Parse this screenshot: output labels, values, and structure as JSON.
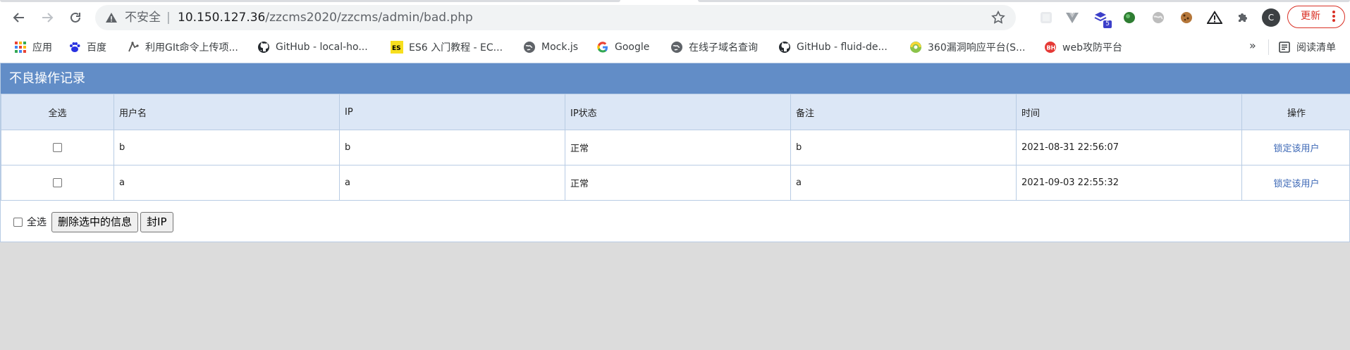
{
  "browser": {
    "security_label": "不安全",
    "url_host": "10.150.127.36",
    "url_path": "/zzcms2020/zzcms/admin/bad.php",
    "extension_badge": "5",
    "profile_initial": "C",
    "update_label": "更新"
  },
  "bookmarks": [
    {
      "label": "应用",
      "icon": "apps-grid-icon"
    },
    {
      "label": "百度",
      "icon": "baidu-paw-icon"
    },
    {
      "label": "利用GIt命令上传项...",
      "icon": "git-icon"
    },
    {
      "label": "GitHub - local-ho...",
      "icon": "github-icon"
    },
    {
      "label": "ES6 入门教程 - EC...",
      "icon": "es6-icon"
    },
    {
      "label": "Mock.js",
      "icon": "globe-icon"
    },
    {
      "label": "Google",
      "icon": "google-icon"
    },
    {
      "label": "在线子域名查询",
      "icon": "globe-icon"
    },
    {
      "label": "GitHub - fluid-de...",
      "icon": "github-icon"
    },
    {
      "label": "360漏洞响应平台(S...",
      "icon": "360-icon"
    },
    {
      "label": "web攻防平台",
      "icon": "web-security-icon"
    }
  ],
  "bookmarks_more": "»",
  "reading_list_label": "阅读清单",
  "panel": {
    "title": "不良操作记录"
  },
  "table": {
    "headers": {
      "select_all": "全选",
      "username": "用户名",
      "ip": "IP",
      "ip_status": "IP状态",
      "note": "备注",
      "time": "时间",
      "action": "操作"
    },
    "rows": [
      {
        "username": "b",
        "ip": "b",
        "ip_status": "正常",
        "note": "b",
        "time": "2021-08-31 22:56:07",
        "action": "锁定该用户"
      },
      {
        "username": "a",
        "ip": "a",
        "ip_status": "正常",
        "note": "a",
        "time": "2021-09-03 22:55:32",
        "action": "锁定该用户"
      }
    ]
  },
  "footer": {
    "select_all_label": "全选",
    "delete_button": "删除选中的信息",
    "ban_ip_button": "封IP"
  },
  "colors": {
    "panel_header": "#628dc7",
    "table_header": "#dce7f6",
    "border": "#b8cce4",
    "link": "#3b67b5",
    "update_accent": "#d93025"
  }
}
